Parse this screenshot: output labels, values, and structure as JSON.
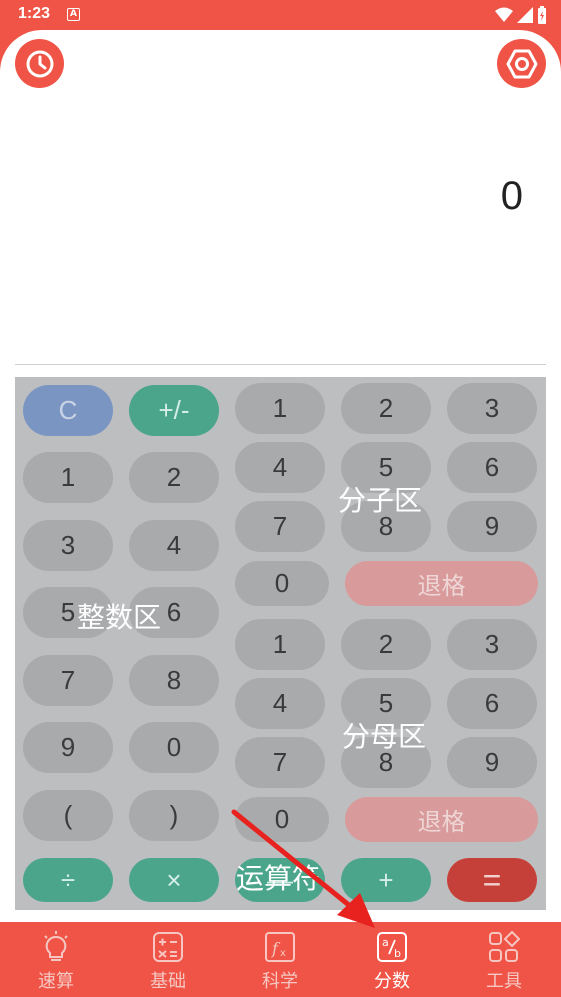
{
  "status": {
    "time": "1:23",
    "notif_icon": "A"
  },
  "header": {
    "left_icon": "clock-icon",
    "right_icon": "settings-icon"
  },
  "display": {
    "value": "0"
  },
  "keypad": {
    "integer": {
      "clear": "C",
      "sign": "+/-",
      "k1": "1",
      "k2": "2",
      "k3": "3",
      "k4": "4",
      "k5": "5",
      "k6": "6",
      "k7": "7",
      "k8": "8",
      "k9": "9",
      "k0": "0",
      "lparen": "(",
      "rparen": ")",
      "zone_label": "整数区"
    },
    "numerator": {
      "k1": "1",
      "k2": "2",
      "k3": "3",
      "k4": "4",
      "k5": "5",
      "k6": "6",
      "k7": "7",
      "k8": "8",
      "k9": "9",
      "k0": "0",
      "backspace": "退格",
      "zone_label": "分子区"
    },
    "denominator": {
      "k1": "1",
      "k2": "2",
      "k3": "3",
      "k4": "4",
      "k5": "5",
      "k6": "6",
      "k7": "7",
      "k8": "8",
      "k9": "9",
      "k0": "0",
      "backspace": "退格",
      "zone_label": "分母区"
    },
    "operators": {
      "divide": "÷",
      "multiply": "×",
      "subtract": "—",
      "add": "+",
      "equals": "=",
      "zone_label": "运算符"
    }
  },
  "tabs": [
    {
      "label": "速算",
      "icon": "lightbulb-icon",
      "active": false
    },
    {
      "label": "基础",
      "icon": "calculator-icon",
      "active": false
    },
    {
      "label": "科学",
      "icon": "function-icon",
      "active": false
    },
    {
      "label": "分数",
      "icon": "fraction-icon",
      "active": true
    },
    {
      "label": "工具",
      "icon": "grid-icon",
      "active": false
    }
  ],
  "colors": {
    "accent": "#ef5446",
    "green": "#4aa58a",
    "blue": "#7a95c2",
    "equals": "#c6403a",
    "arrow": "#e8231f"
  }
}
